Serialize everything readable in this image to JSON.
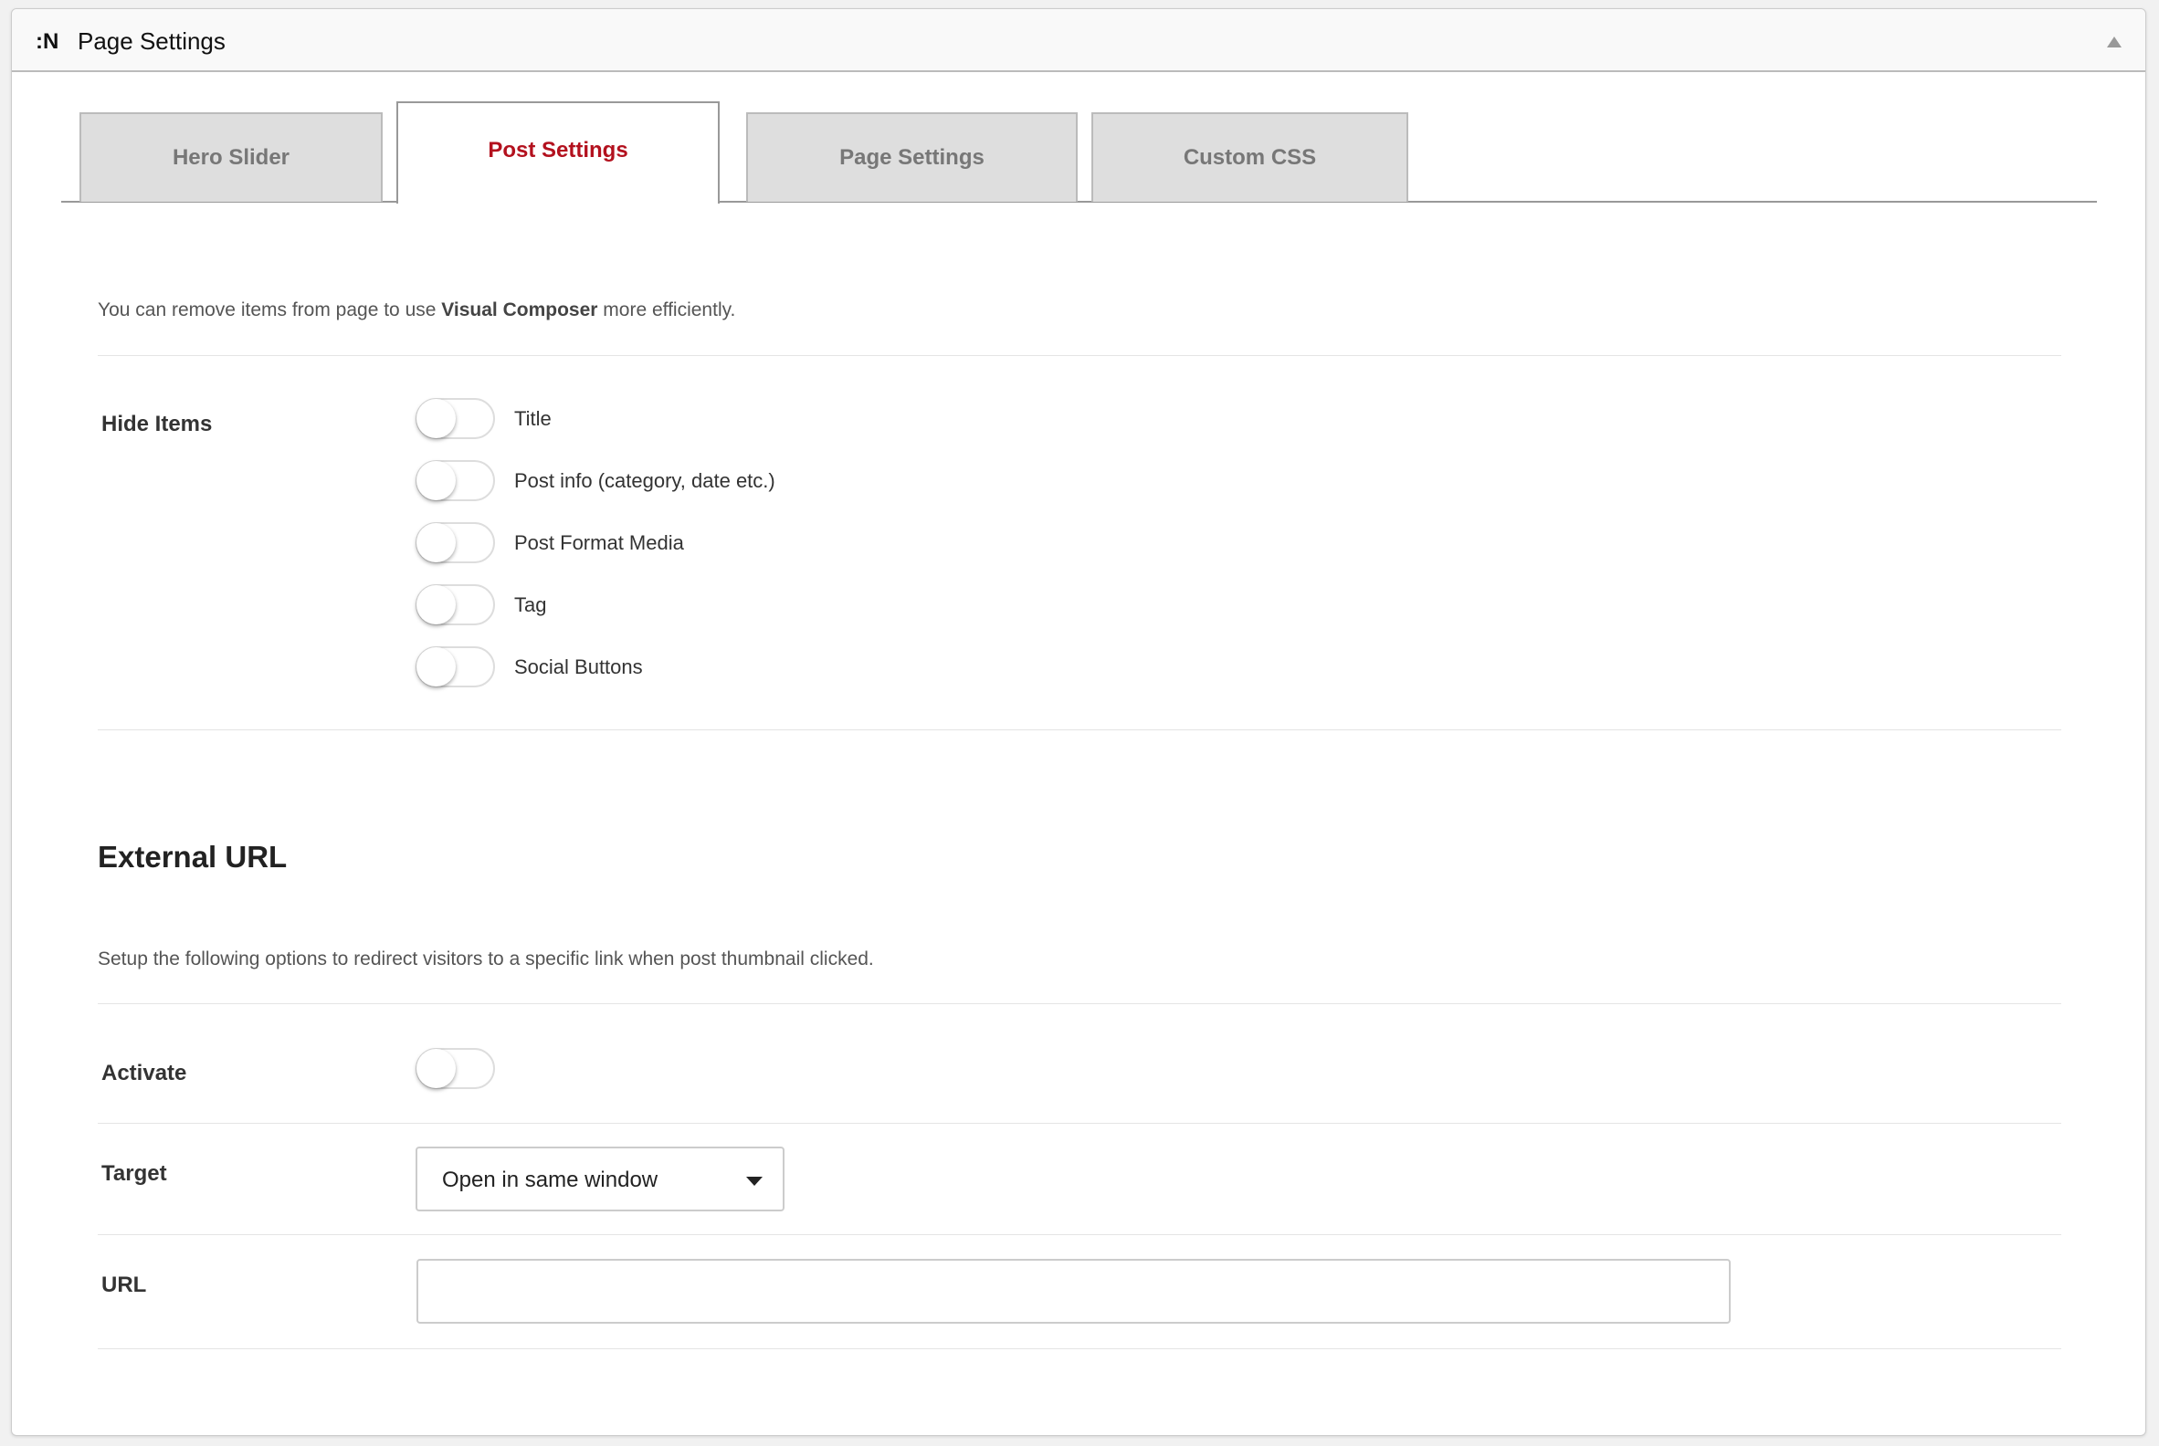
{
  "header": {
    "logo": ":N",
    "title": "Page Settings",
    "collapse_icon": "triangle-up-icon"
  },
  "tabs": [
    {
      "label": "Hero Slider",
      "active": false
    },
    {
      "label": "Post Settings",
      "active": true
    },
    {
      "label": "Page Settings",
      "active": false
    },
    {
      "label": "Custom CSS",
      "active": false
    }
  ],
  "colors": {
    "active_tab": "#b3111e",
    "inactive_tab_bg": "#dedede"
  },
  "post_settings": {
    "intro_prefix": "You can remove items from page to use ",
    "intro_bold": "Visual Composer",
    "intro_suffix": " more efficiently.",
    "hide_items_label": "Hide Items",
    "hide_items": [
      {
        "label": "Title",
        "on": false
      },
      {
        "label": "Post info (category, date etc.)",
        "on": false
      },
      {
        "label": "Post Format Media",
        "on": false
      },
      {
        "label": "Tag",
        "on": false
      },
      {
        "label": "Social Buttons",
        "on": false
      }
    ]
  },
  "external_url": {
    "heading": "External URL",
    "description": "Setup the following options to redirect visitors to a specific link when post thumbnail clicked.",
    "activate_label": "Activate",
    "activate_on": false,
    "target_label": "Target",
    "target_value": "Open in same window",
    "url_label": "URL",
    "url_value": ""
  }
}
